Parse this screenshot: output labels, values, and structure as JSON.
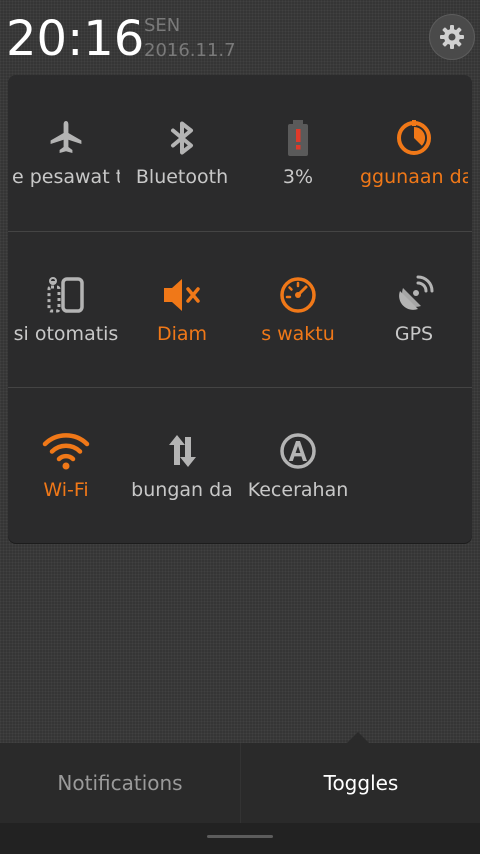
{
  "status": {
    "time": "20:16",
    "day": "SEN",
    "date": "2016.11.7"
  },
  "colors": {
    "accent": "#f07818",
    "icon_inactive": "#b4b4b4",
    "battery_red": "#e03a2a"
  },
  "toggles": [
    {
      "label": "e pesawat t",
      "icon": "airplane-icon",
      "active": false
    },
    {
      "label": "Bluetooth",
      "icon": "bluetooth-icon",
      "active": false
    },
    {
      "label": "3%",
      "icon": "battery-low-icon",
      "active": false
    },
    {
      "label": "ggunaan da",
      "icon": "data-usage-icon",
      "active": true
    },
    {
      "label": "si otomatis",
      "icon": "auto-rotate-icon",
      "active": false
    },
    {
      "label": "Diam",
      "icon": "mute-icon",
      "active": true
    },
    {
      "label": "s waktu",
      "icon": "speedometer-icon",
      "active": true
    },
    {
      "label": "GPS",
      "icon": "gps-icon",
      "active": false
    },
    {
      "label": "Wi-Fi",
      "icon": "wifi-icon",
      "active": true
    },
    {
      "label": "bungan da",
      "icon": "sync-icon",
      "active": false
    },
    {
      "label": "Kecerahan",
      "icon": "auto-brightness-icon",
      "active": false
    }
  ],
  "tabs": {
    "notifications": "Notifications",
    "toggles": "Toggles"
  }
}
